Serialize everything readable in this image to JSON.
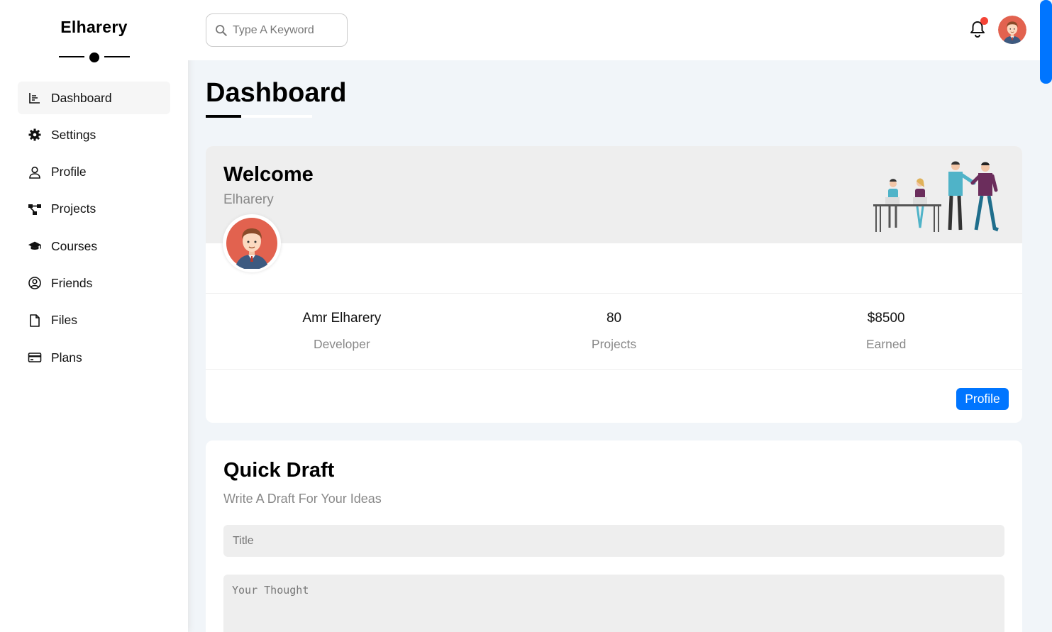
{
  "sidebar": {
    "brand": "Elharery",
    "items": [
      {
        "label": "Dashboard",
        "icon": "chart-icon",
        "active": true
      },
      {
        "label": "Settings",
        "icon": "gear-icon"
      },
      {
        "label": "Profile",
        "icon": "user-icon"
      },
      {
        "label": "Projects",
        "icon": "diagram-project-icon"
      },
      {
        "label": "Courses",
        "icon": "graduation-cap-icon"
      },
      {
        "label": "Friends",
        "icon": "user-circle-icon"
      },
      {
        "label": "Files",
        "icon": "file-icon"
      },
      {
        "label": "Plans",
        "icon": "credit-card-icon"
      }
    ]
  },
  "header": {
    "search_placeholder": "Type A Keyword"
  },
  "page": {
    "title": "Dashboard"
  },
  "welcome": {
    "title": "Welcome",
    "subtitle": "Elharery",
    "stats": [
      {
        "value": "Amr Elharery",
        "label": "Developer"
      },
      {
        "value": "80",
        "label": "Projects"
      },
      {
        "value": "$8500",
        "label": "Earned"
      }
    ],
    "button": "Profile"
  },
  "draft": {
    "title": "Quick Draft",
    "subtitle": "Write A Draft For Your Ideas",
    "title_placeholder": "Title",
    "thought_placeholder": "Your Thought"
  },
  "colors": {
    "accent": "#0075ff",
    "badge": "#f44336",
    "background": "#f1f5f9"
  }
}
